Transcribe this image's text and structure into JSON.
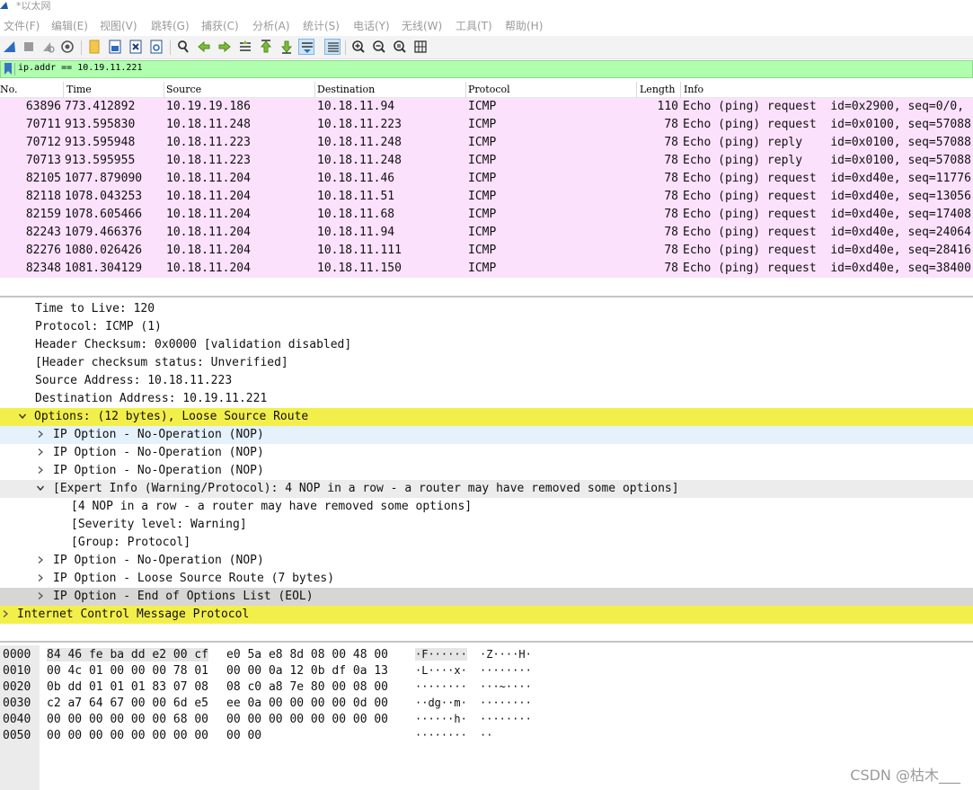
{
  "window": {
    "title": "*以太网"
  },
  "menu": [
    "文件(F)",
    "编辑(E)",
    "视图(V)",
    "跳转(G)",
    "捕获(C)",
    "分析(A)",
    "统计(S)",
    "电话(Y)",
    "无线(W)",
    "工具(T)",
    "帮助(H)"
  ],
  "toolbar": {
    "icons": [
      "shark-fin-start-icon",
      "stop-icon",
      "restart-icon",
      "capture-options-icon",
      "open-folder-icon",
      "save-file-icon",
      "close-file-icon",
      "reload-icon",
      "find-icon",
      "go-back-icon",
      "go-forward-icon",
      "go-to-packet-icon",
      "go-first-icon",
      "go-last-icon",
      "autoscroll-icon",
      "colorize-icon",
      "zoom-in-icon",
      "zoom-out-icon",
      "zoom-normal-icon",
      "resize-columns-icon"
    ]
  },
  "filter": {
    "value": "ip.addr == 10.19.11.221",
    "bg_color": "#afffaf"
  },
  "packet_list": {
    "columns": [
      "No.",
      "Time",
      "Source",
      "Destination",
      "Protocol",
      "Length",
      "Info"
    ],
    "row_color": "#fbe1fb",
    "rows": [
      {
        "no": "63896",
        "time": "773.412892",
        "source": "10.19.19.186",
        "destination": "10.18.11.94",
        "protocol": "ICMP",
        "length": "110",
        "info": "Echo (ping) request  id=0x2900, seq=0/0,"
      },
      {
        "no": "70711",
        "time": "913.595830",
        "source": "10.18.11.248",
        "destination": "10.18.11.223",
        "protocol": "ICMP",
        "length": "78",
        "info": "Echo (ping) request  id=0x0100, seq=57088"
      },
      {
        "no": "70712",
        "time": "913.595948",
        "source": "10.18.11.223",
        "destination": "10.18.11.248",
        "protocol": "ICMP",
        "length": "78",
        "info": "Echo (ping) reply    id=0x0100, seq=57088"
      },
      {
        "no": "70713",
        "time": "913.595955",
        "source": "10.18.11.223",
        "destination": "10.18.11.248",
        "protocol": "ICMP",
        "length": "78",
        "info": "Echo (ping) reply    id=0x0100, seq=57088"
      },
      {
        "no": "82105",
        "time": "1077.879090",
        "source": "10.18.11.204",
        "destination": "10.18.11.46",
        "protocol": "ICMP",
        "length": "78",
        "info": "Echo (ping) request  id=0xd40e, seq=11776"
      },
      {
        "no": "82118",
        "time": "1078.043253",
        "source": "10.18.11.204",
        "destination": "10.18.11.51",
        "protocol": "ICMP",
        "length": "78",
        "info": "Echo (ping) request  id=0xd40e, seq=13056"
      },
      {
        "no": "82159",
        "time": "1078.605466",
        "source": "10.18.11.204",
        "destination": "10.18.11.68",
        "protocol": "ICMP",
        "length": "78",
        "info": "Echo (ping) request  id=0xd40e, seq=17408"
      },
      {
        "no": "82243",
        "time": "1079.466376",
        "source": "10.18.11.204",
        "destination": "10.18.11.94",
        "protocol": "ICMP",
        "length": "78",
        "info": "Echo (ping) request  id=0xd40e, seq=24064"
      },
      {
        "no": "82276",
        "time": "1080.026426",
        "source": "10.18.11.204",
        "destination": "10.18.11.111",
        "protocol": "ICMP",
        "length": "78",
        "info": "Echo (ping) request  id=0xd40e, seq=28416"
      },
      {
        "no": "82348",
        "time": "1081.304129",
        "source": "10.18.11.204",
        "destination": "10.18.11.150",
        "protocol": "ICMP",
        "length": "78",
        "info": "Echo (ping) request  id=0xd40e, seq=38400"
      }
    ]
  },
  "detail_tree": [
    {
      "text": "Time to Live: 120",
      "state": "none"
    },
    {
      "text": "Protocol: ICMP (1)",
      "state": "none"
    },
    {
      "text": "Header Checksum: 0x0000 [validation disabled]",
      "state": "none"
    },
    {
      "text": "[Header checksum status: Unverified]",
      "state": "none"
    },
    {
      "text": "Source Address: 10.18.11.223",
      "state": "none"
    },
    {
      "text": "Destination Address: 10.19.11.221",
      "state": "none"
    },
    {
      "text": "Options: (12 bytes), Loose Source Route",
      "state": "expanded",
      "highlight": "yellow"
    },
    {
      "text": "IP Option - No-Operation (NOP)",
      "state": "collapsed",
      "highlight": "hover"
    },
    {
      "text": "IP Option - No-Operation (NOP)",
      "state": "collapsed"
    },
    {
      "text": "IP Option - No-Operation (NOP)",
      "state": "collapsed"
    },
    {
      "text": "[Expert Info (Warning/Protocol): 4 NOP in a row - a router may have removed some options]",
      "state": "expanded",
      "highlight": "lightgrey"
    },
    {
      "text": "[4 NOP in a row - a router may have removed some options]",
      "state": "none"
    },
    {
      "text": "[Severity level: Warning]",
      "state": "none"
    },
    {
      "text": "[Group: Protocol]",
      "state": "none"
    },
    {
      "text": "IP Option - No-Operation (NOP)",
      "state": "collapsed"
    },
    {
      "text": "IP Option - Loose Source Route (7 bytes)",
      "state": "collapsed"
    },
    {
      "text": "IP Option - End of Options List (EOL)",
      "state": "collapsed",
      "highlight": "grey"
    },
    {
      "text": "Internet Control Message Protocol",
      "state": "collapsed",
      "highlight": "yellow"
    }
  ],
  "bytes": [
    {
      "offset": "0000",
      "hex1": "84 46 fe ba dd e2 00 cf",
      "hex2": "e0 5a e8 8d 08 00 48 00",
      "ascii1": "·F······",
      "ascii2": "·Z····H·"
    },
    {
      "offset": "0010",
      "hex1": "00 4c 01 00 00 00 78 01",
      "hex2": "00 00 0a 12 0b df 0a 13",
      "ascii1": "·L····x·",
      "ascii2": "········"
    },
    {
      "offset": "0020",
      "hex1": "0b dd 01 01 01 83 07 08",
      "hex2": "08 c0 a8 7e 80 00 08 00",
      "ascii1": "········",
      "ascii2": "···~····"
    },
    {
      "offset": "0030",
      "hex1": "c2 a7 64 67 00 00 6d e5",
      "hex2": "ee 0a 00 00 00 00 0d 00",
      "ascii1": "··dg··m·",
      "ascii2": "········"
    },
    {
      "offset": "0040",
      "hex1": "00 00 00 00 00 00 68 00",
      "hex2": "00 00 00 00 00 00 00 00",
      "ascii1": "······h·",
      "ascii2": "········"
    },
    {
      "offset": "0050",
      "hex1": "00 00 00 00 00 00 00 00",
      "hex2": "00 00",
      "ascii1": "········",
      "ascii2": "··"
    }
  ],
  "watermark": "CSDN @枯木___",
  "colors": {
    "option_highlight": "#f3ef4a",
    "selected_hover": "#e5f1fb",
    "packet_row": "#fbe1fb"
  }
}
